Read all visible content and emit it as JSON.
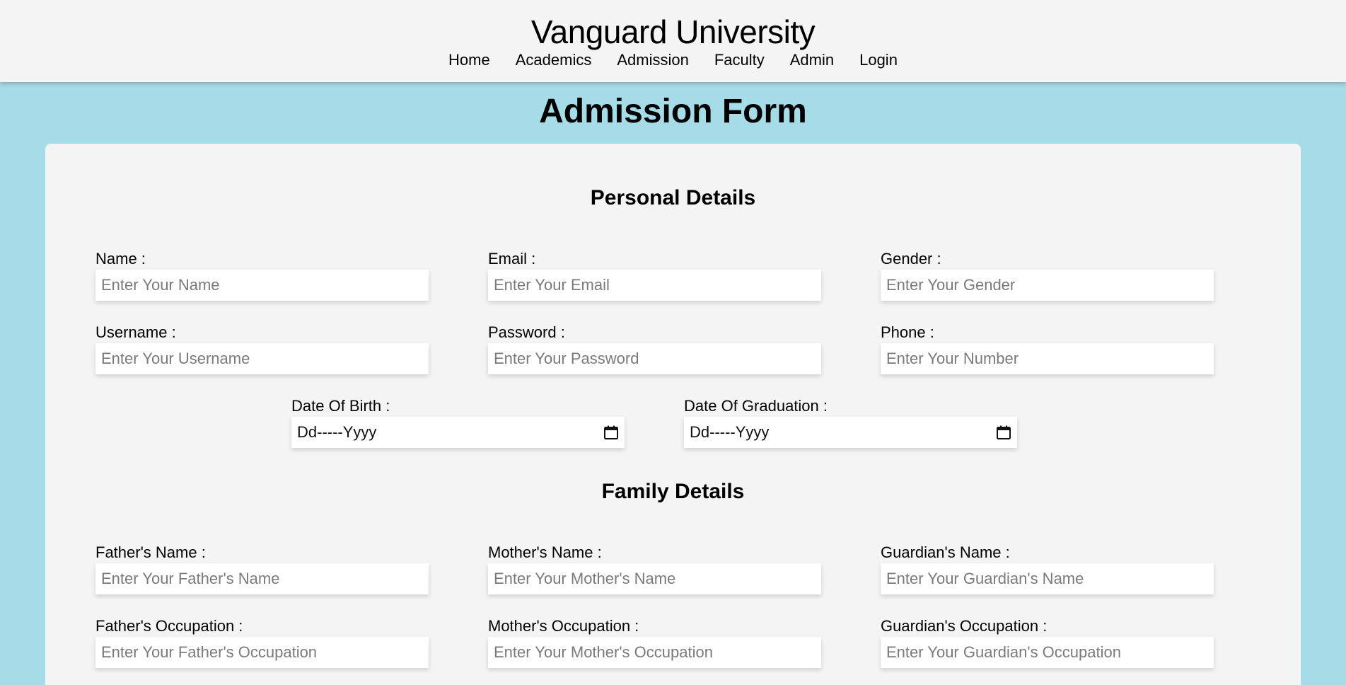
{
  "header": {
    "site_title": "Vanguard University",
    "nav": [
      "Home",
      "Academics",
      "Admission",
      "Faculty",
      "Admin",
      "Login"
    ]
  },
  "page_title": "Admission Form",
  "personal": {
    "title": "Personal Details",
    "name": {
      "label": "Name :",
      "placeholder": "Enter Your Name"
    },
    "email": {
      "label": "Email :",
      "placeholder": "Enter Your Email"
    },
    "gender": {
      "label": "Gender :",
      "placeholder": "Enter Your Gender"
    },
    "username": {
      "label": "Username :",
      "placeholder": "Enter Your Username"
    },
    "password": {
      "label": "Password :",
      "placeholder": "Enter Your Password"
    },
    "phone": {
      "label": "Phone :",
      "placeholder": "Enter Your Number"
    },
    "dob": {
      "label": "Date Of Birth :",
      "value": "Dd-----Yyyy"
    },
    "dog": {
      "label": "Date Of Graduation :",
      "value": "Dd-----Yyyy"
    }
  },
  "family": {
    "title": "Family Details",
    "father_name": {
      "label": "Father's Name :",
      "placeholder": "Enter Your Father's Name"
    },
    "mother_name": {
      "label": "Mother's Name :",
      "placeholder": "Enter Your Mother's Name"
    },
    "guardian_name": {
      "label": "Guardian's Name :",
      "placeholder": "Enter Your Guardian's Name"
    },
    "father_occupation": {
      "label": "Father's Occupation :",
      "placeholder": "Enter Your Father's Occupation"
    },
    "mother_occupation": {
      "label": "Mother's Occupation :",
      "placeholder": "Enter Your Mother's Occupation"
    },
    "guardian_occupation": {
      "label": "Guardian's Occupation :",
      "placeholder": "Enter Your Guardian's Occupation"
    }
  },
  "icons": {
    "date_picker": "calendar-icon"
  },
  "colors": {
    "background": "#a6dbe8",
    "header": "#f4f4f4",
    "card": "#f4f4f4"
  }
}
